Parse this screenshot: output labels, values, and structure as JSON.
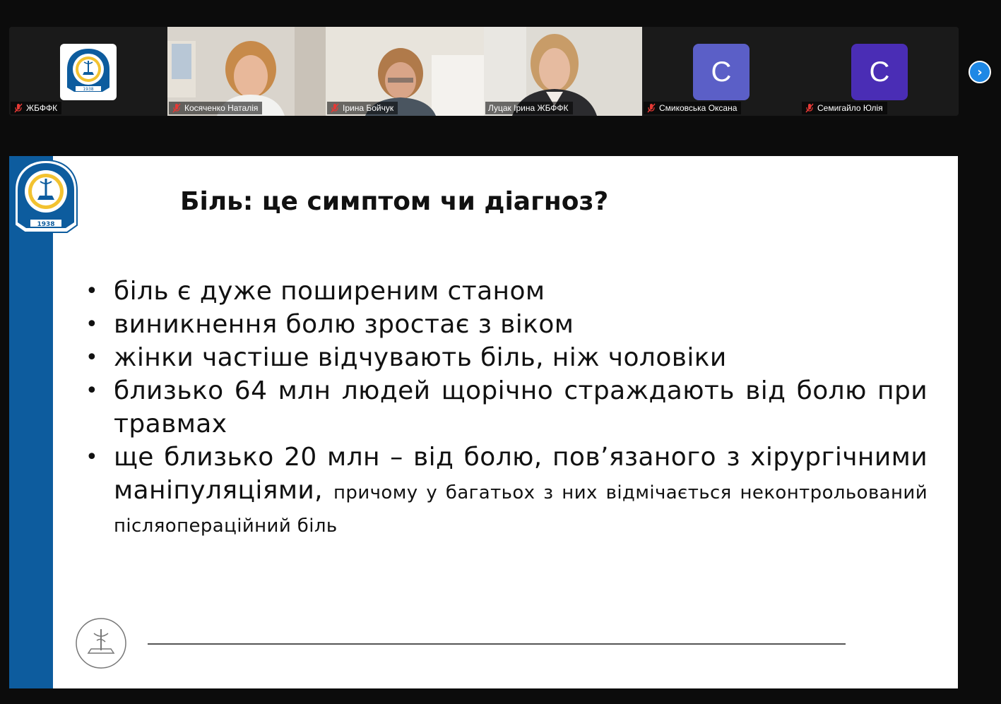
{
  "participants": [
    {
      "name": "ЖБФФК",
      "type": "logo",
      "muted": true
    },
    {
      "name": "Косяченко Наталія",
      "type": "video",
      "muted": true
    },
    {
      "name": "Ірина Бойчук",
      "type": "video",
      "muted": true
    },
    {
      "name": "Луцак Ірина ЖБФФК",
      "type": "video",
      "muted": false,
      "active": true
    },
    {
      "name": "Смиковська Оксана",
      "type": "avatar",
      "initial": "С",
      "color": "#5b5fc7",
      "muted": true
    },
    {
      "name": "Семигайло Юлія",
      "type": "avatar",
      "initial": "С",
      "color": "#4a2db5",
      "muted": true
    }
  ],
  "logo": {
    "year": "1938"
  },
  "slide": {
    "title": "Біль: це симптом чи діагноз?",
    "bullets": [
      "біль є дуже поширеним станом",
      "виникнення болю зростає з віком",
      "жінки частіше відчувають біль, ніж чоловіки",
      "близько 64 млн людей щорічно страждають від болю при травмах"
    ],
    "last_bullet_main": "ще близько 20 млн – від болю, пов’язаного з хірургічними маніпуляціями,",
    "last_bullet_small": "причому у багатьох з них відмічається неконтрольований післяопераційний біль"
  },
  "colors": {
    "accent_blue": "#0d5c9e",
    "active_border": "#2ecc71",
    "next_button": "#1e88e5"
  },
  "icons": {
    "mic": "mic-muted-icon",
    "next": "chevron-right-icon"
  }
}
